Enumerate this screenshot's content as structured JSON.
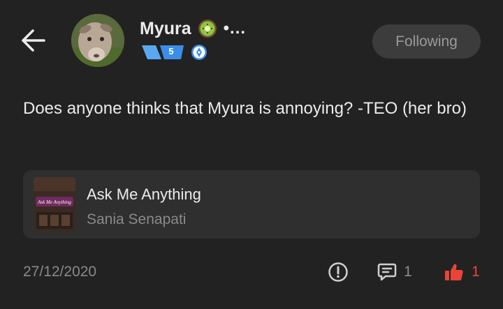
{
  "header": {
    "username": "Myura",
    "more_indicator": "•...",
    "level": "5",
    "follow_label": "Following"
  },
  "post": {
    "text": "Does anyone thinks that Myura is annoying? -TEO (her bro)",
    "date": "27/12/2020",
    "comment_count": "1",
    "like_count": "1"
  },
  "linked_card": {
    "title": "Ask Me Anything",
    "author": "Sania Senapati",
    "thumb_text": "Ask Me Anything"
  },
  "colors": {
    "background": "#222222",
    "card": "#2f2f2f",
    "level_badge": "#3b8ee8",
    "like_red": "#e8443a"
  },
  "icons": {
    "back": "back-arrow-icon",
    "status": "kiwi-icon",
    "badge": "leader-badge-icon",
    "report": "report-icon",
    "comment": "comment-icon",
    "like": "thumbs-up-icon"
  }
}
